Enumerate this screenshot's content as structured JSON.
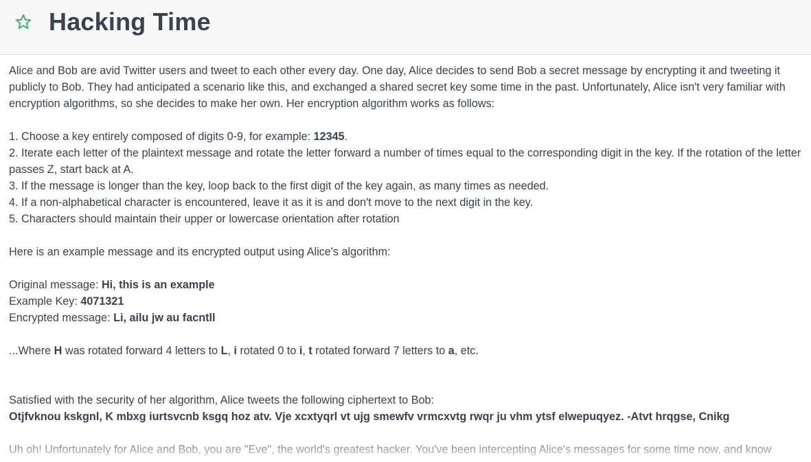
{
  "header": {
    "title": "Hacking Time",
    "star_icon": "star-outline-icon",
    "star_color": "#3bb167"
  },
  "problem": {
    "intro": "Alice and Bob are avid Twitter users and tweet to each other every day. One day, Alice decides to send Bob a secret message by encrypting it and tweeting it publicly to Bob. They had anticipated a scenario like this, and exchanged a shared secret key some time in the past. Unfortunately, Alice isn't very familiar with encryption algorithms, so she decides to make her own. Her encryption algorithm works as follows:",
    "rule1_text": "1. Choose a key entirely composed of digits 0-9, for example: ",
    "rule1_key": "12345",
    "rule1_end": ".",
    "rule2": "2. Iterate each letter of the plaintext message and rotate the letter forward a number of times equal to the corresponding digit in the key. If the rotation of the letter passes Z, start back at A.",
    "rule3": "3. If the message is longer than the key, loop back to the first digit of the key again, as many times as needed.",
    "rule4": "4. If a non-alphabetical character is encountered, leave it as it is and don't move to the next digit in the key.",
    "rule5": "5. Characters should maintain their upper or lowercase orientation after rotation",
    "example_intro": "Here is an example message and its encrypted output using Alice's algorithm:",
    "original_label": "Original message: ",
    "original_value": "Hi, this is an example",
    "key_label": "Example Key: ",
    "key_value": "4071321",
    "encrypted_label": "Encrypted message: ",
    "encrypted_value": "Li, ailu jw au facntll",
    "where_prefix": "...Where ",
    "where_h": "H",
    "where_t1": " was rotated forward 4 letters to ",
    "where_l": "L",
    "where_c1": ", ",
    "where_i1": "i",
    "where_t2": " rotated 0 to ",
    "where_i2": "i",
    "where_c2": ", ",
    "where_t": "t",
    "where_t3": " rotated forward 7 letters to ",
    "where_a": "a",
    "where_end": ", etc.",
    "satisfied": "Satisfied with the security of her algorithm, Alice tweets the following ciphertext to Bob:",
    "ciphertext": "Otjfvknou kskgnl, K mbxg iurtsvcnb ksgq hoz atv. Vje xcxtyqrl vt ujg smewfv vrmcxvtg rwqr ju vhm ytsf elwepuqyez. -Atvt hrqgse, Cnikg",
    "eve_text": "Uh oh! Unfortunately for Alice and Bob, you are \"Eve\", the world's greatest hacker. You've been intercepting Alice's messages for some time now, and know"
  }
}
